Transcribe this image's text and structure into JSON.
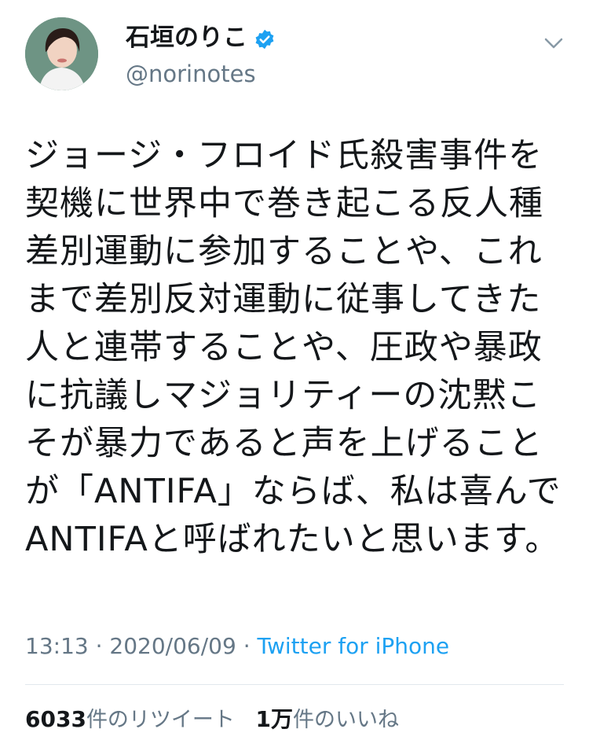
{
  "header": {
    "display_name": "石垣のりこ",
    "handle": "@norinotes",
    "avatar_icon": "user-avatar",
    "verified_icon": "verified-badge-icon",
    "menu_icon": "chevron-down-icon"
  },
  "tweet": {
    "text": "ジョージ・フロイド氏殺害事件を\n契機に世界中で巻き起こる反人種\n差別運動に参加することや、これ\nまで差別反対運動に従事してきた\n人と連帯することや、圧政や暴政\nに抗議しマジョリティーの沈黙こ\nそが暴力であると声を上げること\nが「ANTIFA」ならば、私は喜んで\nANTIFAと呼ばれたいと思います。"
  },
  "meta": {
    "time": "13:13",
    "separator1": " · ",
    "date": "2020/06/09",
    "separator2": " · ",
    "source": "Twitter for iPhone"
  },
  "stats": {
    "retweet_count": "6033",
    "retweet_label": "件のリツイート",
    "like_count": "1万",
    "like_label": "件のいいね"
  },
  "colors": {
    "link": "#1da1f2",
    "secondary_text": "#657786",
    "primary_text": "#14171a",
    "divider": "#e1e8ed"
  }
}
